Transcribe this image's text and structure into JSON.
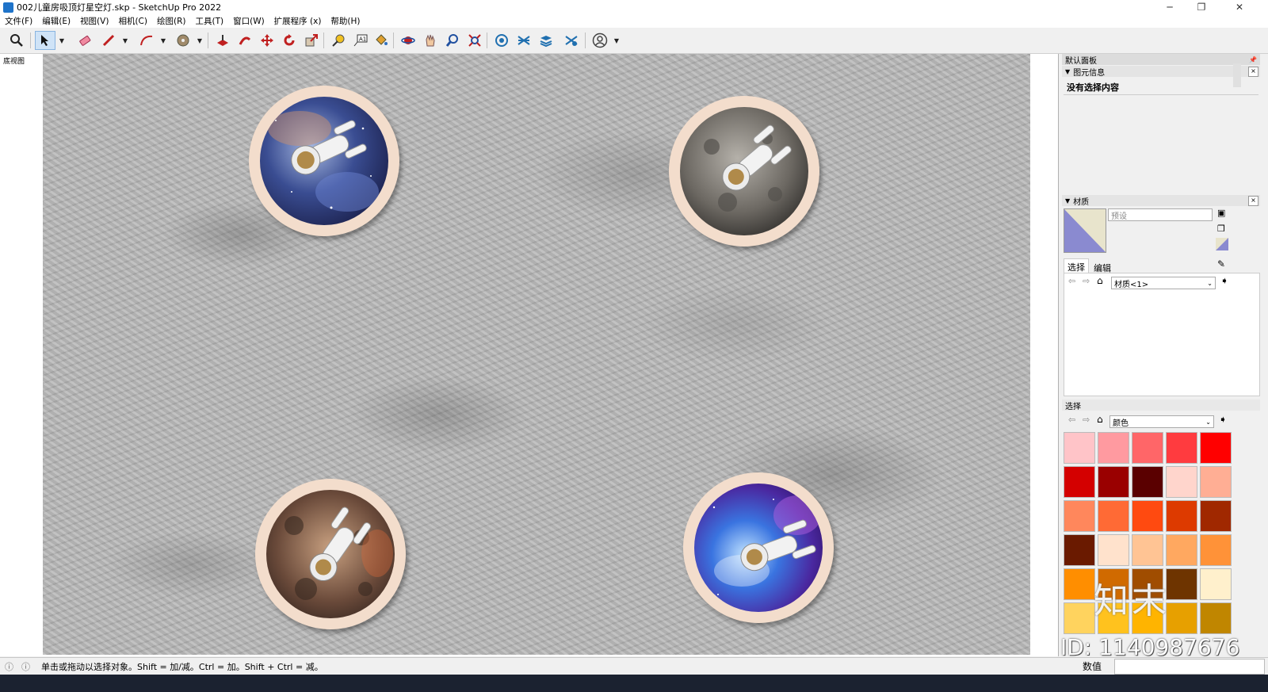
{
  "window": {
    "title": "002儿童房吸顶灯星空灯.skp - SketchUp Pro 2022"
  },
  "menu": [
    "文件(F)",
    "编辑(E)",
    "视图(V)",
    "相机(C)",
    "绘图(R)",
    "工具(T)",
    "窗口(W)",
    "扩展程序 (x)",
    "帮助(H)"
  ],
  "viewport": {
    "scene_label": "底视图"
  },
  "lamps": [
    {
      "name": "lamp-nebula",
      "theme": "nebula"
    },
    {
      "name": "lamp-moon",
      "theme": "moon"
    },
    {
      "name": "lamp-rock",
      "theme": "rock"
    },
    {
      "name": "lamp-galaxy",
      "theme": "galaxy"
    }
  ],
  "panel": {
    "title": "默认面板",
    "entity_info": {
      "header": "图元信息",
      "no_selection": "没有选择内容"
    },
    "materials": {
      "header": "材质",
      "preset_placeholder": "预设",
      "tab_select": "选择",
      "tab_edit": "编辑",
      "material_dropdown": "材质<1>"
    },
    "colors": {
      "header": "选择",
      "dropdown": "颜色",
      "swatches": [
        "#ffc4c8",
        "#ff9aa0",
        "#ff6668",
        "#ff3b3f",
        "#ff0000",
        "#d40000",
        "#9a0000",
        "#5a0000",
        "#ffd5cc",
        "#ffae94",
        "#ff875c",
        "#ff6a35",
        "#ff4a10",
        "#dd3a00",
        "#a02800",
        "#6a1a00",
        "#ffe2cc",
        "#ffc494",
        "#ffa860",
        "#ff9238",
        "#ff8e00",
        "#d06a00",
        "#a04d00",
        "#6e3400",
        "#fff0cc",
        "#ffd35e",
        "#ffc21e",
        "#ffb400",
        "#e7a000",
        "#c08600"
      ]
    }
  },
  "status": {
    "hint": "单击或拖动以选择对象。Shift = 加/减。Ctrl = 加。Shift + Ctrl = 减。",
    "measure_label": "数值"
  },
  "watermark": {
    "logo": "知末",
    "id": "ID: 1140987676"
  }
}
